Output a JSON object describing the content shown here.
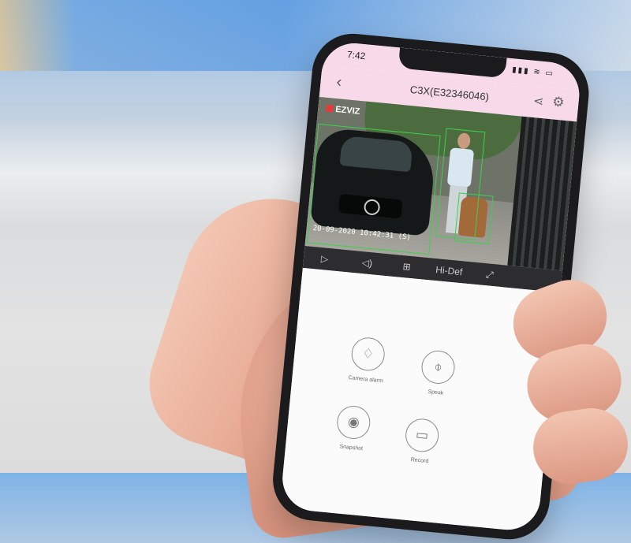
{
  "status_bar": {
    "time": "7:42",
    "icons": "▮▮▮ ≋ ▭"
  },
  "nav": {
    "title": "C3X(E32346046)",
    "back_icon": "chevron-left-icon",
    "share_icon": "share-icon",
    "settings_icon": "gear-icon"
  },
  "video": {
    "brand": "EZVIZ",
    "timestamp": "20-09-2020 10:42:31 (S)"
  },
  "controls": {
    "play": "▷",
    "sound": "◁)",
    "layout": "⊞",
    "quality": "Hi-Def",
    "fullscreen": "⤢"
  },
  "functions": {
    "camera_alarm": "Camera alarm",
    "speak": "Speak",
    "snapshot": "Snapshot",
    "record": "Record"
  },
  "colors": {
    "header": "#f7d9ea",
    "detection_box": "#3bd14a"
  }
}
